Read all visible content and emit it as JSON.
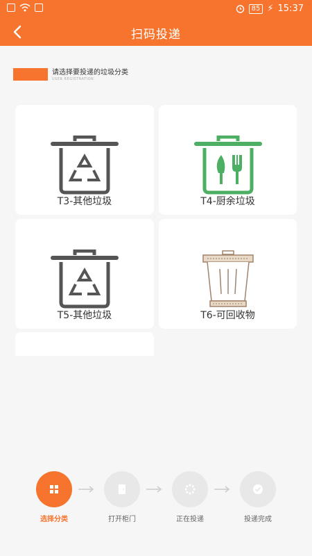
{
  "status_bar": {
    "battery": "85",
    "time": "15:37"
  },
  "header": {
    "title": "扫码投递"
  },
  "section": {
    "title": "请选择要投递的垃圾分类",
    "subtitle": "USER REGISTRATION"
  },
  "bins": [
    {
      "label": "T3-其他垃圾",
      "icon": "recycle-bin-icon",
      "color": "#555555"
    },
    {
      "label": "T4-厨余垃圾",
      "icon": "kitchen-waste-bin-icon",
      "color": "#4caf63"
    },
    {
      "label": "T5-其他垃圾",
      "icon": "recycle-bin-icon",
      "color": "#555555"
    },
    {
      "label": "T6-可回收物",
      "icon": "recyclable-bin-icon",
      "color": "#a0826a"
    }
  ],
  "steps": [
    {
      "label": "选择分类",
      "icon": "grid-icon",
      "active": true
    },
    {
      "label": "打开柜门",
      "icon": "door-icon",
      "active": false
    },
    {
      "label": "正在投递",
      "icon": "loading-icon",
      "active": false
    },
    {
      "label": "投递完成",
      "icon": "check-icon",
      "active": false
    }
  ],
  "colors": {
    "accent": "#f7742e",
    "kitchen": "#4caf63",
    "other": "#555555",
    "recyclable": "#a0826a"
  }
}
